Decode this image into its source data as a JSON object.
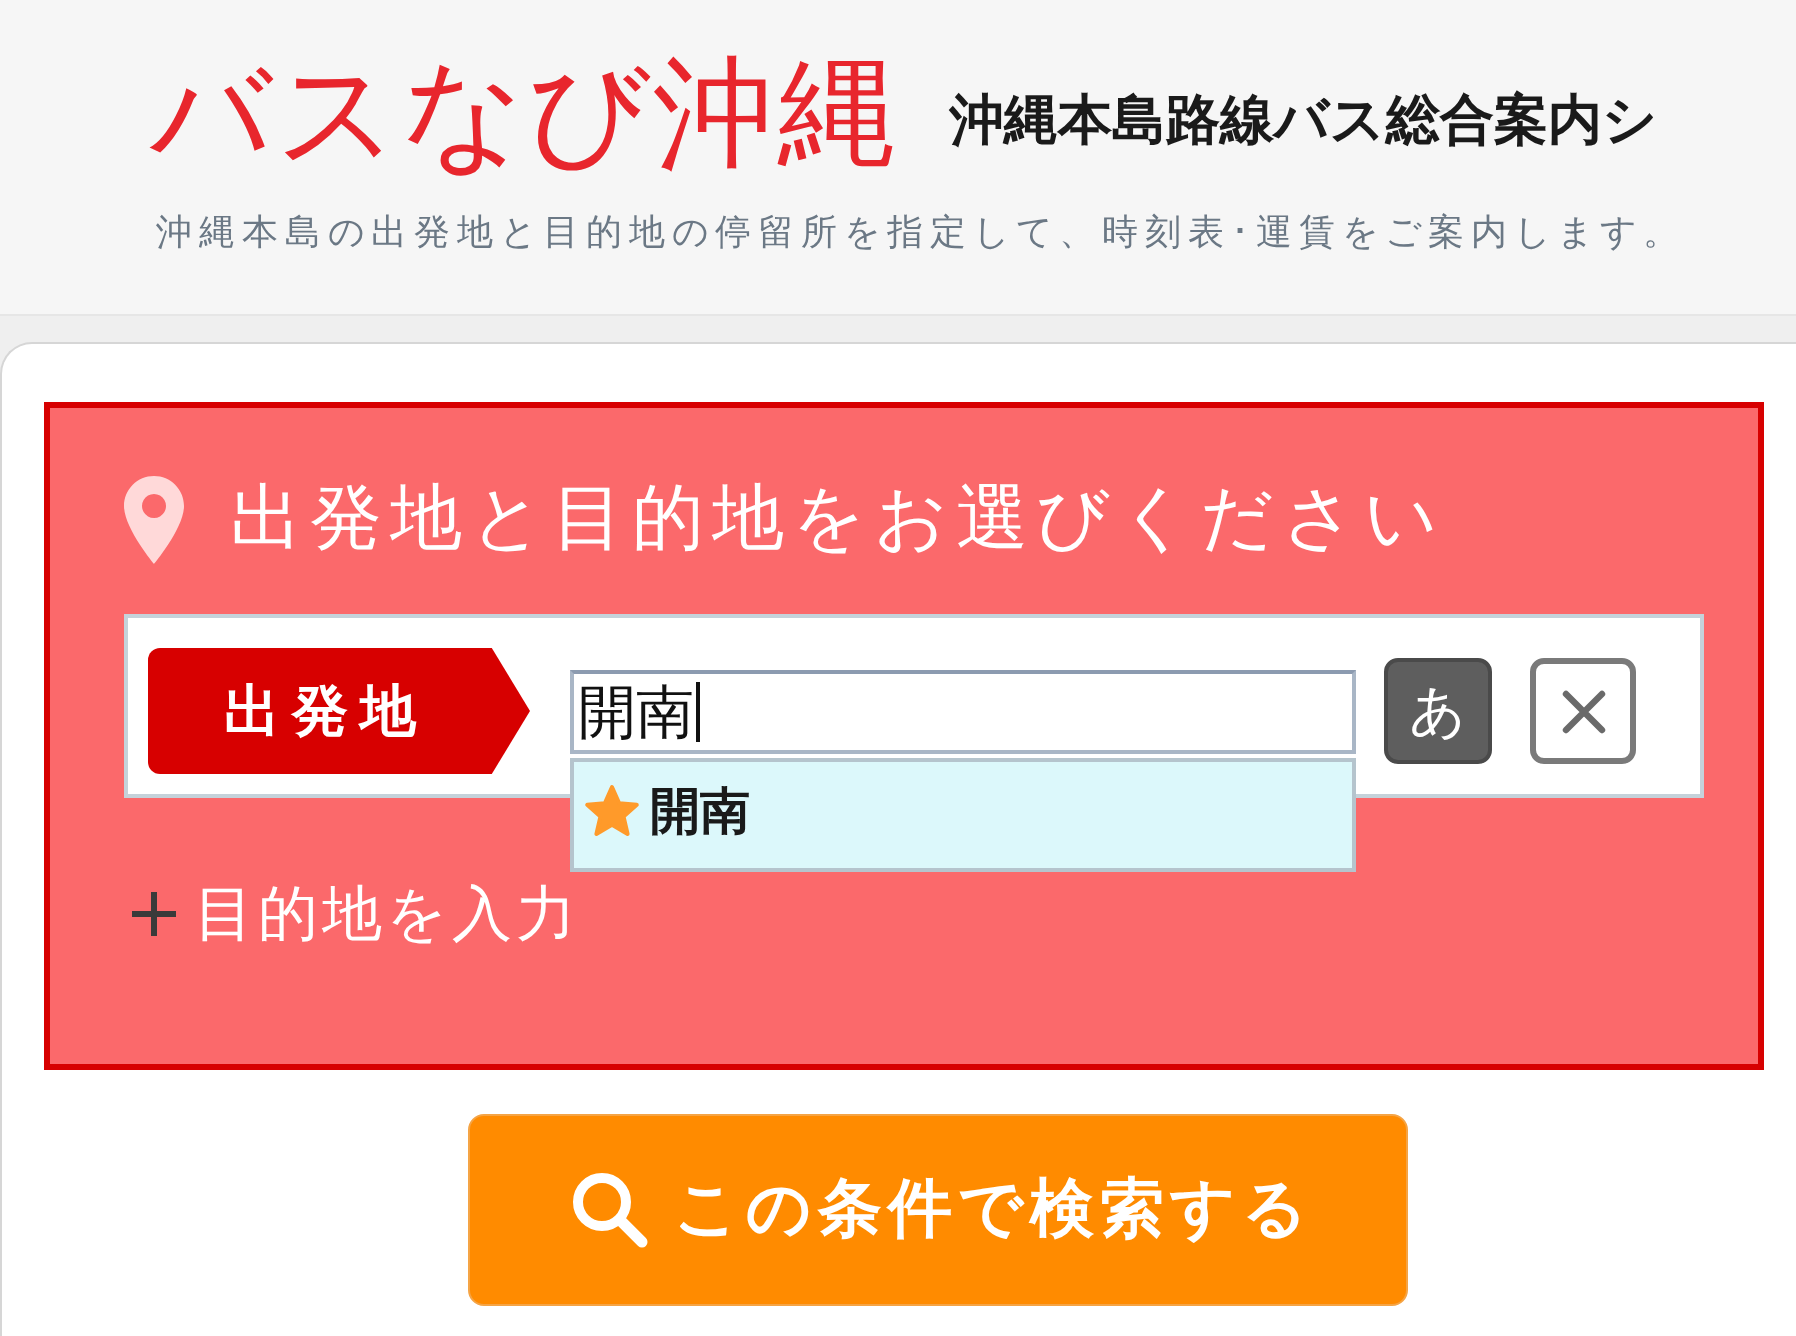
{
  "header": {
    "logo": "バスなび沖縄",
    "tagline": "沖縄本島路線バス総合案内シ",
    "description": "沖縄本島の出発地と目的地の停留所を指定して、時刻表･運賃をご案内します。"
  },
  "search_panel": {
    "title": "出発地と目的地をお選びください",
    "origin": {
      "label": "出発地",
      "value": "開南",
      "suggestions": [
        {
          "label": "開南"
        }
      ],
      "kana_button": "あ"
    },
    "add_destination": "目的地を入力"
  },
  "search_button": "この条件で検索する"
}
